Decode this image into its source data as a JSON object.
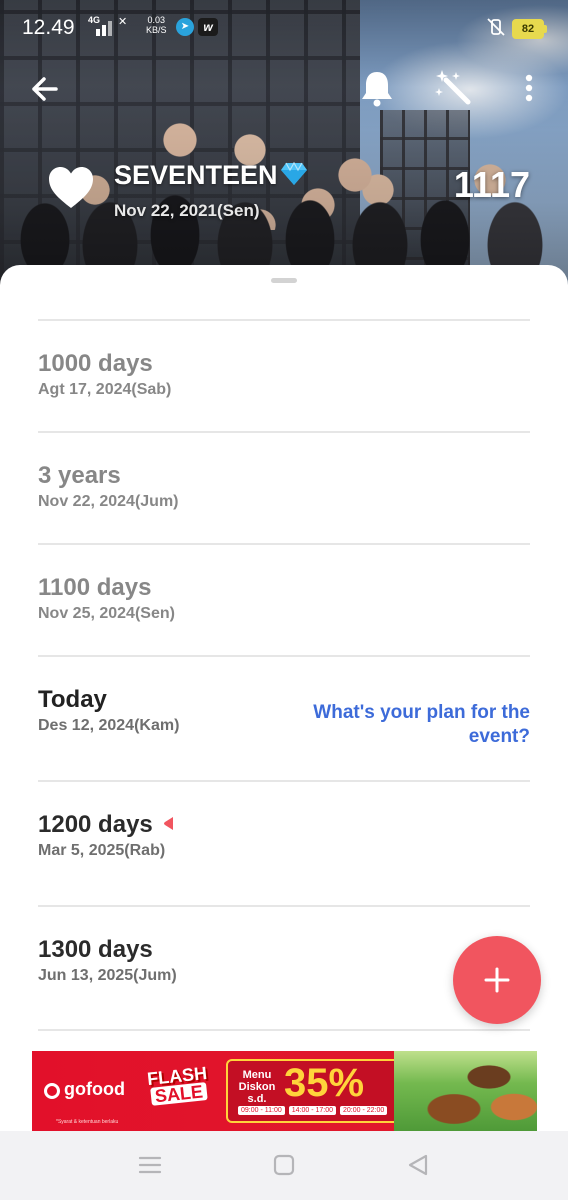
{
  "status_bar": {
    "time": "12.49",
    "network": "4G",
    "speed_value": "0.03",
    "speed_unit": "KB/S",
    "battery": "82"
  },
  "header": {
    "title": "SEVENTEEN",
    "start_date": "Nov 22, 2021(Sen)",
    "days_count": "1117"
  },
  "milestones": [
    {
      "title": "1000 days",
      "date": "Agt 17, 2024(Sab)",
      "state": "past"
    },
    {
      "title": "3 years",
      "date": "Nov 22, 2024(Jum)",
      "state": "past"
    },
    {
      "title": "1100 days",
      "date": "Nov 25, 2024(Sen)",
      "state": "past"
    },
    {
      "title": "Today",
      "date": "Des 12, 2024(Kam)",
      "state": "today"
    },
    {
      "title": "1200 days",
      "date": "Mar 5, 2025(Rab)",
      "state": "future"
    },
    {
      "title": "1300 days",
      "date": "Jun 13, 2025(Jum)",
      "state": "future"
    }
  ],
  "today_plan_link": "What's your plan for the event?",
  "ad": {
    "brand": "gofood",
    "flash": "FLASH",
    "sale": "SALE",
    "menu_diskon": "Menu Diskon s.d.",
    "discount": "35%",
    "times": [
      "09:00 - 11:00",
      "14:00 - 17:00",
      "20:00 - 22:00"
    ],
    "fine_print": "*Syarat & ketentuan berlaku"
  },
  "colors": {
    "accent_fab": "#f1555f",
    "link": "#3d6bd9",
    "battery": "#e7d94e"
  },
  "icons": {
    "back": "arrow-left-icon",
    "bell": "bell-icon",
    "magic": "magic-wand-icon",
    "more": "more-vertical-icon",
    "heart": "heart-icon",
    "diamond": "diamond-icon",
    "add": "plus-icon"
  }
}
